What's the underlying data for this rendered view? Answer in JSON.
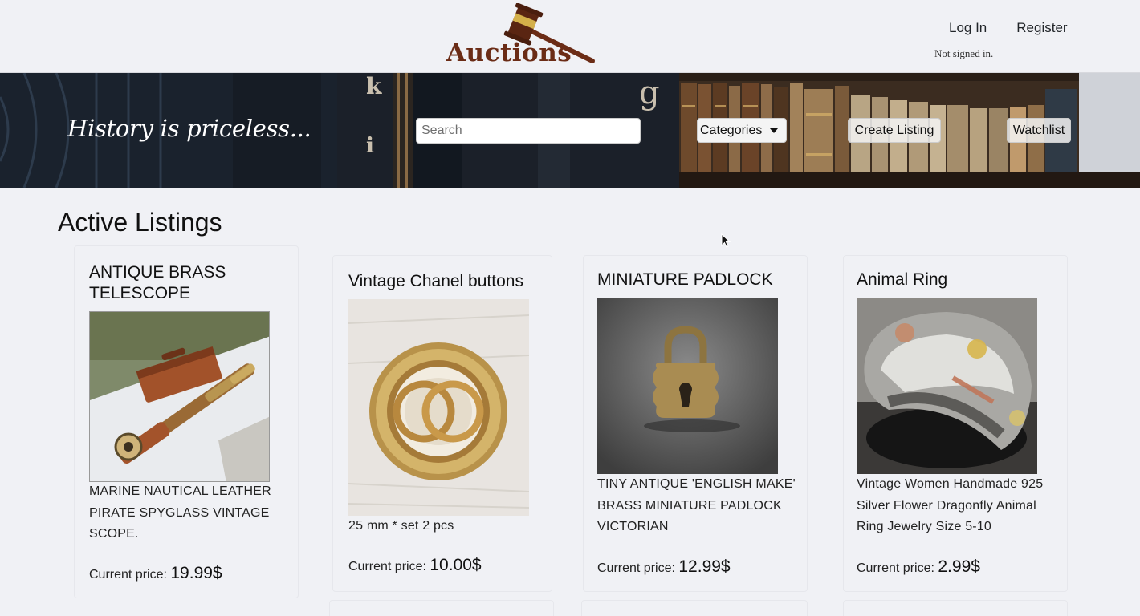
{
  "header": {
    "logo_text": "Auctions",
    "login_label": "Log In",
    "register_label": "Register",
    "signed_status": "Not signed in."
  },
  "banner": {
    "tagline": "History is priceless...",
    "search_placeholder": "Search",
    "categories_label": "Categories",
    "create_listing_label": "Create Listing",
    "watchlist_label": "Watchlist",
    "decor_letters": [
      "k",
      "i",
      "g"
    ]
  },
  "main": {
    "title": "Active Listings",
    "price_prefix": "Current price:",
    "listings": [
      {
        "title": "ANTIQUE BRASS TELESCOPE",
        "description": "MARINE NAUTICAL LEATHER PIRATE SPYGLASS VINTAGE SCOPE.",
        "price": "19.99$",
        "image": "telescope-photo"
      },
      {
        "title": "Vintage Chanel buttons",
        "description": "25 mm * set 2 pcs",
        "price": "10.00$",
        "image": "chanel-button-photo"
      },
      {
        "title": "MINIATURE PADLOCK",
        "description": "TINY ANTIQUE 'ENGLISH MAKE' BRASS MINIATURE PADLOCK VICTORIAN",
        "price": "12.99$",
        "image": "padlock-photo"
      },
      {
        "title": "Animal Ring",
        "description": "Vintage Women Handmade 925 Silver Flower Dragonfly Animal Ring Jewelry Size 5-10",
        "price": "2.99$",
        "image": "ring-photo"
      }
    ]
  },
  "colors": {
    "page_bg": "#f0f1f5",
    "logo_brown": "#6b2c16",
    "text": "#212529"
  }
}
